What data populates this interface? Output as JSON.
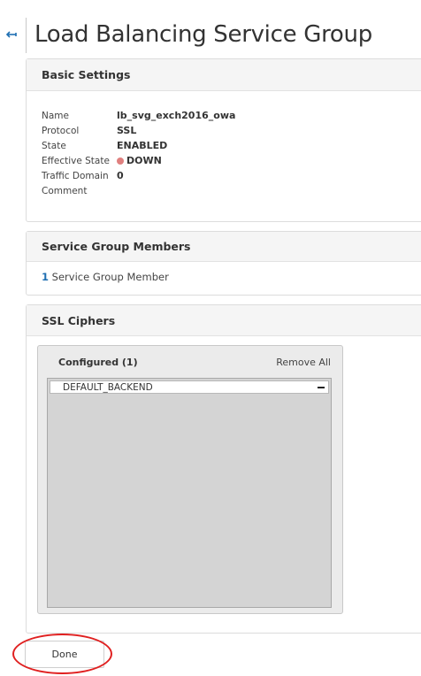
{
  "page": {
    "title": "Load Balancing Service Group"
  },
  "basic_settings": {
    "header": "Basic Settings",
    "rows": [
      {
        "label": "Name",
        "value": "lb_svg_exch2016_owa"
      },
      {
        "label": "Protocol",
        "value": "SSL"
      },
      {
        "label": "State",
        "value": "ENABLED"
      },
      {
        "label": "Effective State",
        "value": "DOWN"
      },
      {
        "label": "Traffic Domain",
        "value": "0"
      },
      {
        "label": "Comment",
        "value": ""
      }
    ],
    "status_color": "#e0807f"
  },
  "service_group_members": {
    "header": "Service Group Members",
    "count": "1",
    "label": "Service Group Member"
  },
  "ssl_ciphers": {
    "header": "SSL Ciphers",
    "configured_label": "Configured (1)",
    "remove_all_label": "Remove All",
    "items": [
      "DEFAULT_BACKEND"
    ]
  },
  "footer": {
    "done_label": "Done"
  },
  "icons": {
    "back": "back-arrow-icon",
    "remove": "minus-icon"
  }
}
